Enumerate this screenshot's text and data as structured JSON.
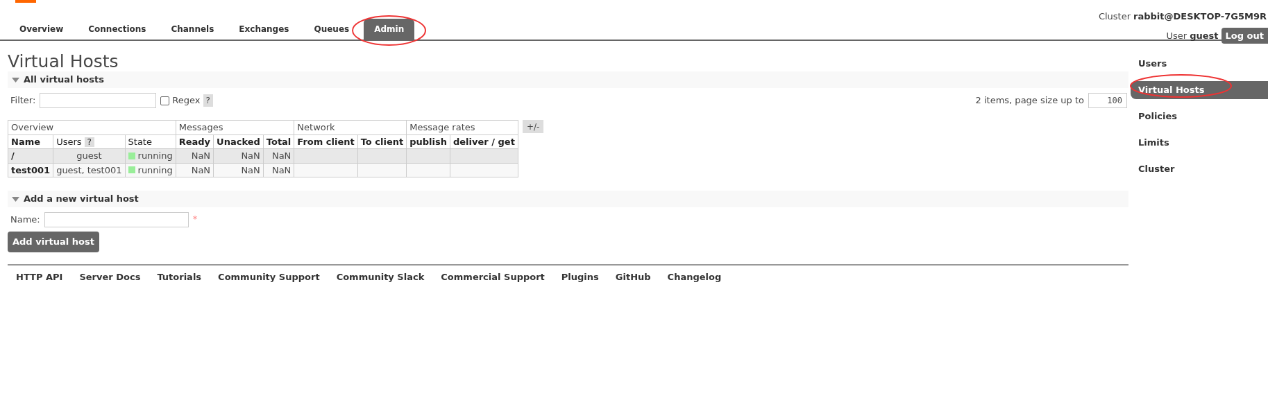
{
  "header": {
    "cluster_label": "Cluster",
    "cluster_name": "rabbit@DESKTOP-7G5M9R",
    "user_label": "User",
    "user_name": "guest",
    "logout": "Log out"
  },
  "tabs": [
    {
      "label": "Overview",
      "selected": false
    },
    {
      "label": "Connections",
      "selected": false
    },
    {
      "label": "Channels",
      "selected": false
    },
    {
      "label": "Exchanges",
      "selected": false
    },
    {
      "label": "Queues",
      "selected": false
    },
    {
      "label": "Admin",
      "selected": true
    }
  ],
  "page_title": "Virtual Hosts",
  "vhosts_section": {
    "title": "All virtual hosts",
    "expanded": true
  },
  "filter": {
    "label": "Filter:",
    "regex_label": "Regex",
    "regex_checked": false,
    "help": "?"
  },
  "paging": {
    "text": "2 items, page size up to",
    "page_size": "100"
  },
  "table": {
    "groups": [
      {
        "label": "Overview"
      },
      {
        "label": "Messages"
      },
      {
        "label": "Network"
      },
      {
        "label": "Message rates"
      }
    ],
    "toggle": "+/-",
    "columns": [
      {
        "label": "Name",
        "bold": true
      },
      {
        "label": "Users",
        "bold": false,
        "help": "?"
      },
      {
        "label": "State",
        "bold": false
      },
      {
        "label": "Ready",
        "bold": true
      },
      {
        "label": "Unacked",
        "bold": true
      },
      {
        "label": "Total",
        "bold": true
      },
      {
        "label": "From client",
        "bold": true
      },
      {
        "label": "To client",
        "bold": true
      },
      {
        "label": "publish",
        "bold": true
      },
      {
        "label": "deliver / get",
        "bold": true
      }
    ],
    "rows": [
      {
        "name": "/",
        "users": "guest",
        "state": "running",
        "color": "#99ee99",
        "ready": "NaN",
        "unacked": "NaN",
        "total": "NaN"
      },
      {
        "name": "test001",
        "users": "guest, test001",
        "state": "running",
        "color": "#99ee99",
        "ready": "NaN",
        "unacked": "NaN",
        "total": "NaN"
      }
    ]
  },
  "add_section": {
    "title": "Add a new virtual host",
    "expanded": true,
    "name_label": "Name:",
    "required_mark": "*",
    "button": "Add virtual host"
  },
  "sidebar": {
    "items": [
      {
        "label": "Users",
        "selected": false
      },
      {
        "label": "Virtual Hosts",
        "selected": true
      },
      {
        "label": "Policies",
        "selected": false
      },
      {
        "label": "Limits",
        "selected": false
      },
      {
        "label": "Cluster",
        "selected": false
      }
    ]
  },
  "footer": {
    "links": [
      "HTTP API",
      "Server Docs",
      "Tutorials",
      "Community Support",
      "Community Slack",
      "Commercial Support",
      "Plugins",
      "GitHub",
      "Changelog"
    ]
  }
}
